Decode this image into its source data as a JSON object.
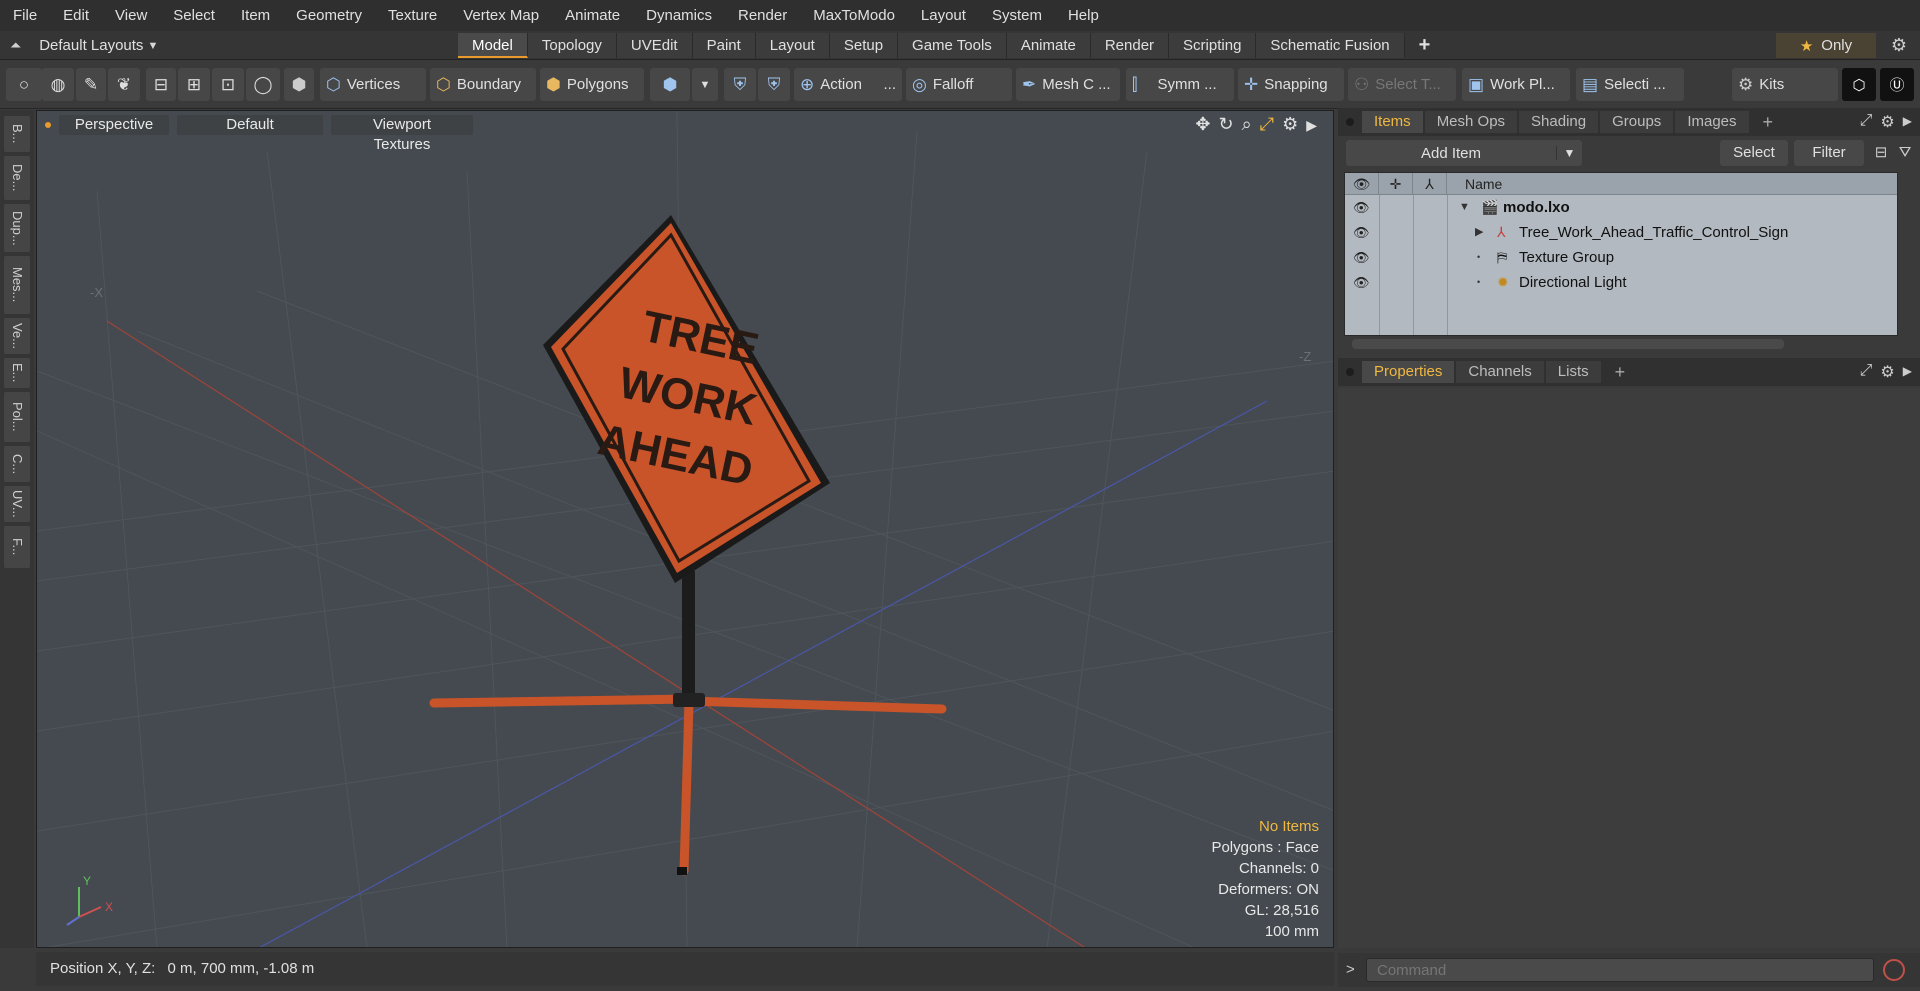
{
  "menu": [
    "File",
    "Edit",
    "View",
    "Select",
    "Item",
    "Geometry",
    "Texture",
    "Vertex Map",
    "Animate",
    "Dynamics",
    "Render",
    "MaxToModo",
    "Layout",
    "System",
    "Help"
  ],
  "layout": {
    "name": "Default Layouts",
    "tabs": [
      "Model",
      "Topology",
      "UVEdit",
      "Paint",
      "Layout",
      "Setup",
      "Game Tools",
      "Animate",
      "Render",
      "Scripting",
      "Schematic Fusion"
    ],
    "active_tab": "Model",
    "add_tab": "+",
    "only_label": "Only"
  },
  "toolbar": {
    "vertices": "Vertices",
    "boundary": "Boundary",
    "polygons": "Polygons",
    "action": "Action",
    "action_more": "...",
    "falloff": "Falloff",
    "mesh": "Mesh C ...",
    "symm": "Symm ...",
    "snapping": "Snapping",
    "select_t": "Select T...",
    "work_pl": "Work Pl...",
    "selecti": "Selecti ...",
    "kits": "Kits"
  },
  "left_tabs": [
    "B...",
    "De...",
    "Dup...",
    "Mes...",
    "Ve...",
    "E...",
    "Pol...",
    "C...",
    "UV...",
    "F..."
  ],
  "viewport": {
    "view": "Perspective",
    "shading": "Default",
    "textures": "Viewport Textures",
    "axis_labels": [
      "-X",
      "-Z"
    ],
    "sign_text": [
      "TREE",
      "WORK",
      "AHEAD"
    ],
    "gizmo": {
      "y": "Y",
      "x": "X"
    },
    "stats": {
      "items": "No Items",
      "polygons": "Polygons : Face",
      "channels": "Channels: 0",
      "deformers": "Deformers: ON",
      "gl": "GL: 28,516",
      "scale": "100 mm"
    }
  },
  "status": {
    "position_label": "Position X, Y, Z:",
    "position_value": "0 m, 700 mm, -1.08 m"
  },
  "items_panel": {
    "tabs": [
      "Items",
      "Mesh Ops",
      "Shading",
      "Groups",
      "Images"
    ],
    "active_tab": "Items",
    "add_item": "Add Item",
    "select": "Select",
    "filter": "Filter",
    "col_name": "Name",
    "tree": [
      {
        "name": "modo.lxo",
        "icon": "scene-icon"
      },
      {
        "name": "Tree_Work_Ahead_Traffic_Control_Sign",
        "icon": "mesh-item-icon"
      },
      {
        "name": "Texture Group",
        "icon": "texture-group-icon"
      },
      {
        "name": "Directional Light",
        "icon": "light-icon"
      }
    ]
  },
  "properties_panel": {
    "tabs": [
      "Properties",
      "Channels",
      "Lists"
    ],
    "active_tab": "Properties"
  },
  "command": {
    "prompt": ">",
    "placeholder": "Command"
  },
  "colors": {
    "accent": "#e89a2c",
    "sign_orange": "#c9542a",
    "viewport_bg": "#444a4f"
  }
}
